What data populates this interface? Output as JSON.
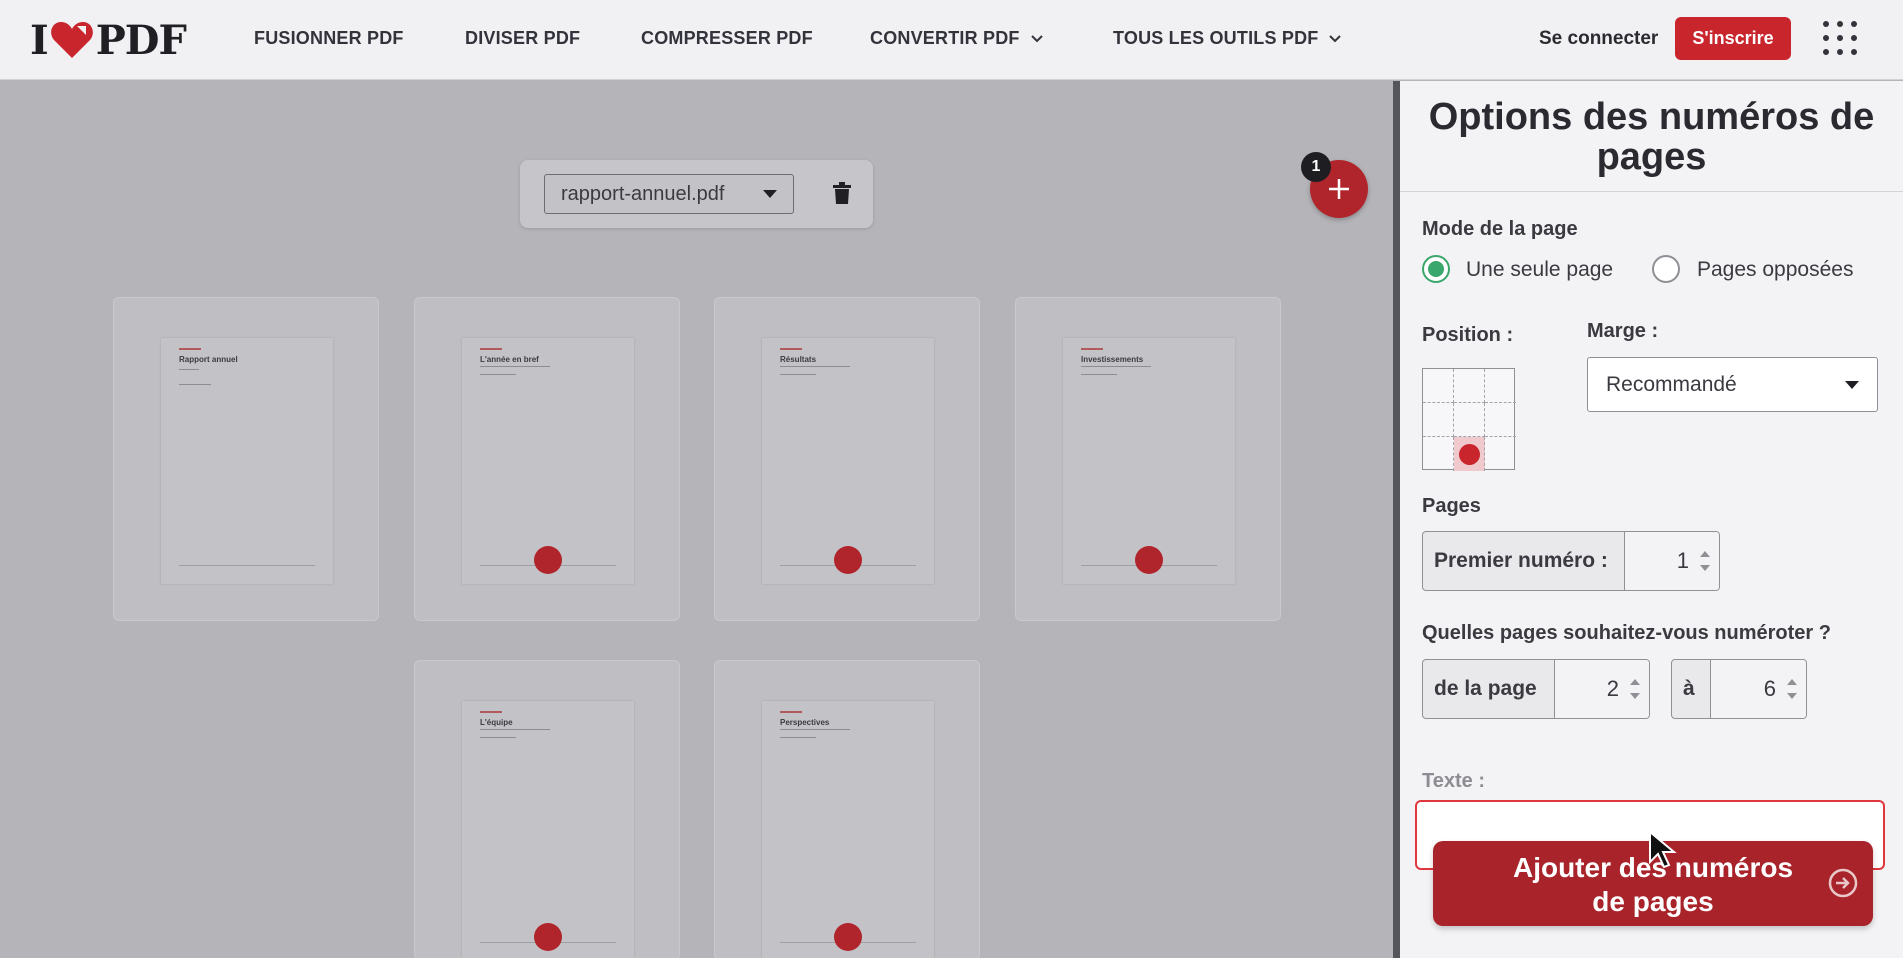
{
  "header": {
    "logo_left": "I",
    "logo_right": "PDF",
    "nav": [
      "FUSIONNER PDF",
      "DIVISER PDF",
      "COMPRESSER PDF",
      "CONVERTIR PDF",
      "TOUS LES OUTILS PDF"
    ],
    "login": "Se connecter",
    "signup": "S'inscrire",
    "brand_color": "#c9252c"
  },
  "workspace": {
    "file_name": "rapport-annuel.pdf",
    "file_count_badge": "1",
    "pages": [
      {
        "title": "Rapport annuel"
      },
      {
        "title": "L'année en bref"
      },
      {
        "title": "Résultats"
      },
      {
        "title": "Investissements"
      },
      {
        "title": "L'équipe"
      },
      {
        "title": "Perspectives"
      }
    ]
  },
  "panel": {
    "title": "Options des numéros de pages",
    "mode_label": "Mode de la page",
    "mode_single": "Une seule page",
    "mode_facing": "Pages opposées",
    "position_label": "Position :",
    "margin_label": "Marge :",
    "margin_value": "Recommandé",
    "pages_label": "Pages",
    "first_number_label": "Premier numéro :",
    "first_number_value": "1",
    "which_pages_label": "Quelles pages souhaitez-vous numéroter ?",
    "from_label": "de la page",
    "from_value": "2",
    "to_label": "à",
    "to_value": "6",
    "text_label": "Texte :",
    "text_value": "",
    "submit_label": "Ajouter des numéros de pages",
    "accent_green": "#3aa76d"
  }
}
